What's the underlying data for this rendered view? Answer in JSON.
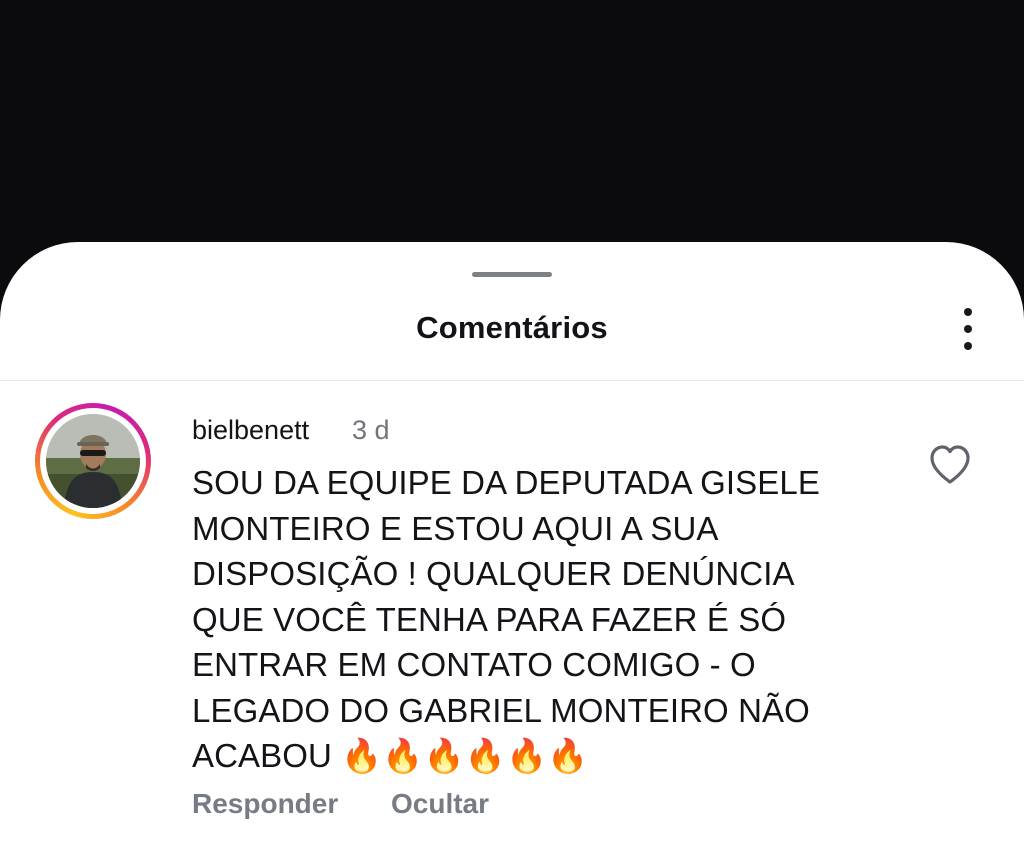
{
  "sheet": {
    "title": "Comentários"
  },
  "comment": {
    "username": "bielbenett",
    "time_ago": "3 d",
    "text": "SOU DA EQUIPE DA DEPUTADA GISELE\nMONTEIRO E ESTOU AQUI A SUA\nDISPOSIÇÃO ! QUALQUER DENÚNCIA\nQUE VOCÊ TENHA PARA FAZER É SÓ\nENTRAR EM CONTATO COMIGO - O\nLEGADO DO GABRIEL MONTEIRO NÃO\nACABOU 🔥🔥🔥🔥🔥🔥",
    "reply_label": "Responder",
    "hide_label": "Ocultar",
    "liked": false
  },
  "icons": {
    "more": "more-vertical-icon",
    "like": "heart-outline-icon"
  },
  "colors": {
    "background": "#0b0b0d",
    "sheet": "#ffffff",
    "primary_text": "#121418",
    "secondary_text": "#767b84",
    "story_ring_start": "#fdc31f",
    "story_ring_end": "#c41ab5"
  }
}
